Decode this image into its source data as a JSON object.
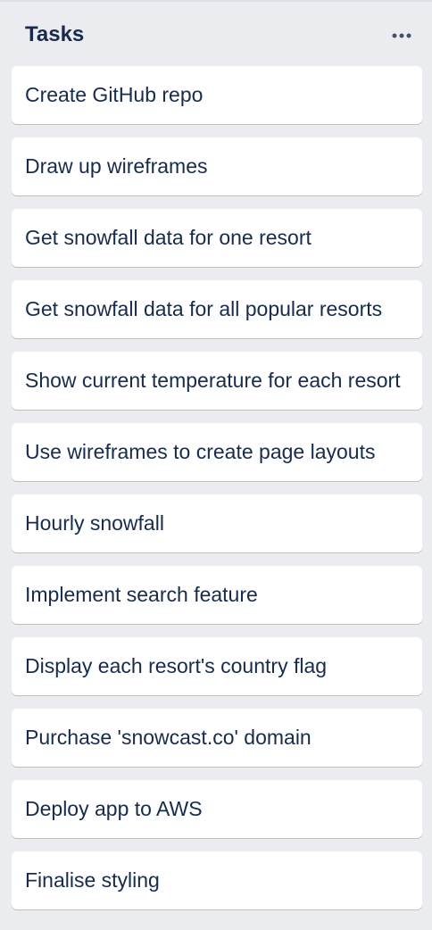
{
  "list": {
    "title": "Tasks",
    "menu_icon": "more-horizontal-icon",
    "cards": [
      {
        "title": "Create GitHub repo"
      },
      {
        "title": "Draw up wireframes"
      },
      {
        "title": "Get snowfall data for one resort"
      },
      {
        "title": "Get snowfall data for all popular resorts"
      },
      {
        "title": "Show current temperature for each resort"
      },
      {
        "title": "Use wireframes to create page layouts"
      },
      {
        "title": "Hourly snowfall"
      },
      {
        "title": "Implement search feature"
      },
      {
        "title": "Display each resort's country flag"
      },
      {
        "title": "Purchase 'snowcast.co' domain"
      },
      {
        "title": "Deploy app to AWS"
      },
      {
        "title": "Finalise styling"
      }
    ]
  },
  "colors": {
    "background": "#ebecf0",
    "card": "#ffffff",
    "text": "#172b4d",
    "icon": "#42526e"
  }
}
